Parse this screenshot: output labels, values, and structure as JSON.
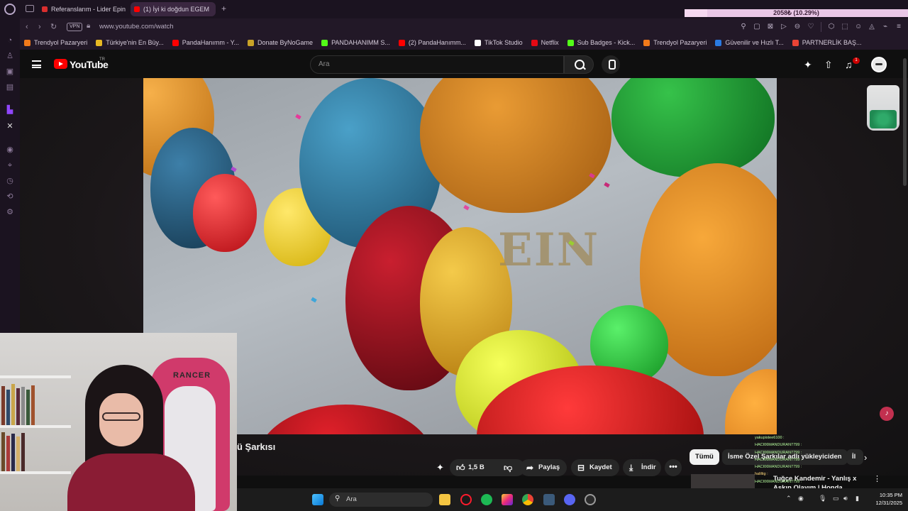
{
  "browser": {
    "tabs": [
      {
        "label": "Referanslarım - Lider Epin",
        "active": false,
        "fav_color": "#d92e2e"
      },
      {
        "label": "(1) İyi ki doğdun EGEM",
        "active": true,
        "fav_color": "#ff0000"
      }
    ],
    "vpn_label": "VPN",
    "url": "www.youtube.com/watch",
    "status_overlay": {
      "text": "2058₺ (10.29%)",
      "progress_percent": 10.29
    },
    "bookmarks": [
      {
        "label": "Trendyol Pazaryeri",
        "color": "#f27a1a"
      },
      {
        "label": "Türkiye'nin En Büy...",
        "color": "#e8b923"
      },
      {
        "label": "PandaHanımm - Y...",
        "color": "#ff0000"
      },
      {
        "label": "Donate ByNoGame",
        "color": "#c9a227"
      },
      {
        "label": "PANDAHANIMM S...",
        "color": "#53fc18"
      },
      {
        "label": "(2) PandaHanımm...",
        "color": "#ff0000"
      },
      {
        "label": "TikTok Studio",
        "color": "#ffffff"
      },
      {
        "label": "Netflix",
        "color": "#e50914"
      },
      {
        "label": "Sub Badges - Kick...",
        "color": "#53fc18"
      },
      {
        "label": "Trendyol Pazaryeri",
        "color": "#f27a1a"
      },
      {
        "label": "Güvenilir ve Hızlı T...",
        "color": "#2a7ae2"
      },
      {
        "label": "PARTNERLİK BAŞ...",
        "color": "#ea4335"
      }
    ]
  },
  "youtube": {
    "wordmark": "YouTube",
    "country_code": "TR",
    "search_placeholder": "Ara",
    "notification_count": "1",
    "video_overlay_text": "EIN",
    "video_title": "ü Şarkısı",
    "actions": {
      "like_count": "1,5 B",
      "share": "Paylaş",
      "save": "Kaydet",
      "download": "İndir",
      "more": "•••"
    },
    "chips": [
      "Tümü",
      "İsme Özel Şarkılar adlı yükleyiciden",
      "İl"
    ],
    "recommended": {
      "title": "Tuğçe Kandemir - Yanlış x Aşkın Olayım | Honda"
    },
    "webcam_chair_brand": "RANCER"
  },
  "chat": [
    {
      "user": "yakupistee6100 :",
      "msg": "",
      "cls": "u1"
    },
    {
      "user": "HACI06MANDURAN7799 :",
      "msg": "",
      "cls": "u1"
    },
    {
      "user": "HACI06MANDURAN7799 :",
      "msg": "",
      "cls": "u1"
    },
    {
      "user": "HACI06MANDURAN7799 :",
      "msg": "",
      "cls": "u1"
    },
    {
      "user": "HACI06MANDURAN7799 :",
      "msg": "",
      "cls": "u1"
    },
    {
      "user": "haliltig :",
      "msg": "",
      "cls": "u2"
    },
    {
      "user": "HACI06MANDURAN7799 :",
      "msg": "",
      "cls": "u1"
    }
  ],
  "taskbar": {
    "search_label": "Ara",
    "time": "10:35 PM",
    "date": "12/31/2025"
  },
  "colors": {
    "accent_youtube": "#ff0000",
    "tab_active_bg": "#3a2740",
    "opera_frame": "#1b1320"
  }
}
